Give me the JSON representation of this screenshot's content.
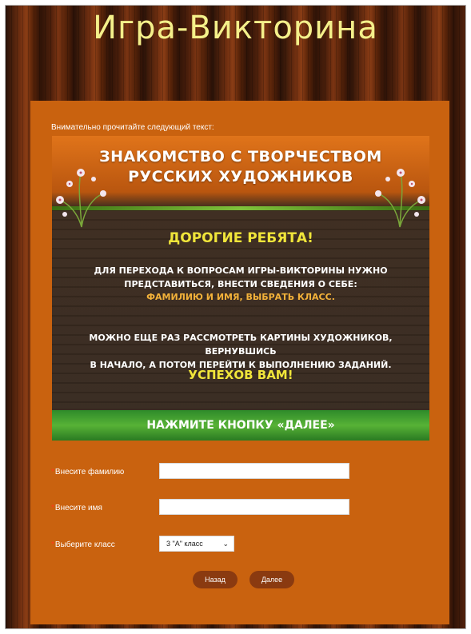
{
  "header": {
    "title": "Игра-Викторина"
  },
  "panel": {
    "instruction": "Внимательно прочитайте следующий текст:"
  },
  "banner": {
    "heading_line1": "ЗНАКОМСТВО С ТВОРЧЕСТВОМ",
    "heading_line2": "РУССКИХ ХУДОЖНИКОВ",
    "greeting": "ДОРОГИЕ РЕБЯТА!",
    "p1_line1": "ДЛЯ ПЕРЕХОДА К ВОПРОСАМ ИГРЫ-ВИКТОРИНЫ НУЖНО",
    "p1_line2": "ПРЕДСТАВИТЬСЯ, ВНЕСТИ СВЕДЕНИЯ О СЕБЕ:",
    "highlight": "ФАМИЛИЮ И ИМЯ, ВЫБРАТЬ КЛАСС.",
    "p2_line1": "МОЖНО ЕЩЕ РАЗ РАССМОТРЕТЬ КАРТИНЫ ХУДОЖНИКОВ, ВЕРНУВШИСЬ",
    "p2_line2": "В НАЧАЛО, А ПОТОМ ПЕРЕЙТИ К ВЫПОЛНЕНИЮ ЗАДАНИЙ.",
    "luck": "УСПЕХОВ ВАМ!",
    "footer": "НАЖМИТЕ КНОПКУ «ДАЛЕЕ»"
  },
  "form": {
    "required_mark": "*",
    "surname_label": "Внесите фамилию",
    "surname_value": "",
    "name_label": "Внесите имя",
    "name_value": "",
    "class_label": "Выберите класс",
    "class_selected": "3 \"А\" класс"
  },
  "buttons": {
    "back": "Назад",
    "next": "Далее"
  },
  "colors": {
    "title": "#f4f08a",
    "panel": "#c9620f",
    "button": "#8a3a10",
    "banner_accent_yellow": "#f0e53a",
    "banner_accent_orange": "#f3b23a",
    "banner_footer_green": "#57b236"
  },
  "icons": {
    "select": "chevron-down-icon",
    "decoration": "flower-icon"
  }
}
